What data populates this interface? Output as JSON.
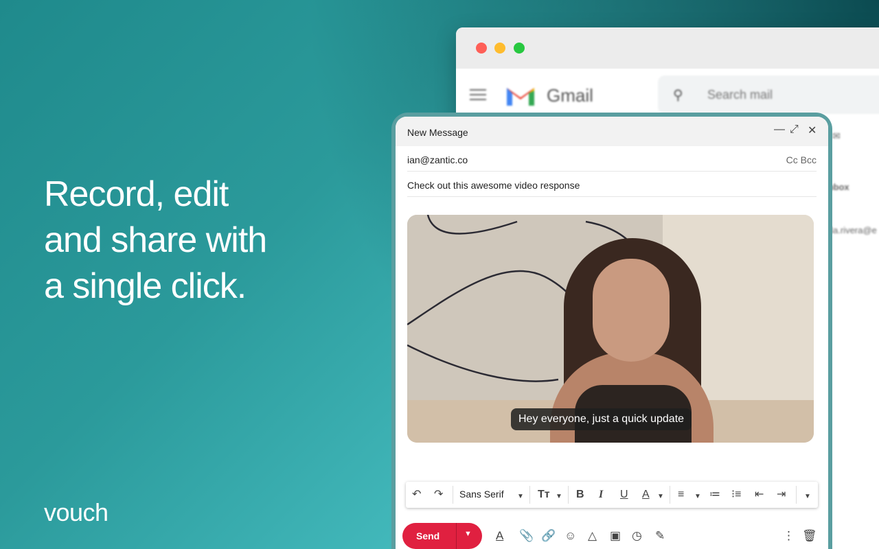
{
  "hero": {
    "lines": [
      "Record, edit",
      "and share with",
      "a single click."
    ],
    "brand": "vouch"
  },
  "gmail": {
    "app_name": "Gmail",
    "search_placeholder": "Search mail",
    "side_label": "Inbox",
    "side_email": "ella.rivera@e"
  },
  "compose": {
    "title": "New Message",
    "to": "ian@zantic.co",
    "cc_bcc": "Cc Bcc",
    "subject": "Check out this awesome video response",
    "video_caption": "Hey everyone, just a quick update",
    "font": "Sans Serif",
    "send_label": "Send"
  },
  "colors": {
    "send": "#e02040",
    "teal": "#2b9a9b"
  }
}
